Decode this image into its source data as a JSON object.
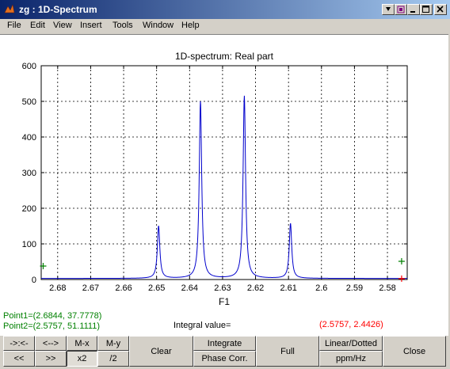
{
  "window": {
    "title": "zg : 1D-Spectrum"
  },
  "menu": [
    "File",
    "Edit",
    "View",
    "Insert",
    "Tools",
    "Window",
    "Help"
  ],
  "chart_data": {
    "type": "line",
    "title": "1D-spectrum: Real part",
    "xlabel": "F1",
    "ylabel": "",
    "xlim": [
      2.685,
      2.574
    ],
    "ylim": [
      0,
      600
    ],
    "x_reversed": true,
    "grid": true,
    "xticks": [
      2.68,
      2.67,
      2.66,
      2.65,
      2.64,
      2.63,
      2.62,
      2.61,
      2.6,
      2.59,
      2.58
    ],
    "xtick_labels": [
      "2.68",
      "2.67",
      "2.66",
      "2.65",
      "2.64",
      "2.63",
      "2.62",
      "2.61",
      "2.6",
      "2.59",
      "2.58"
    ],
    "yticks": [
      0,
      100,
      200,
      300,
      400,
      500,
      600
    ],
    "ytick_labels": [
      "0",
      "100",
      "200",
      "300",
      "400",
      "500",
      "600"
    ],
    "peaks": [
      {
        "x": 2.6494,
        "y": 150
      },
      {
        "x": 2.6367,
        "y": 500
      },
      {
        "x": 2.6234,
        "y": 515
      },
      {
        "x": 2.6094,
        "y": 157
      }
    ],
    "baseline": 3,
    "markers": [
      {
        "x": 2.6844,
        "y": 37.7778,
        "color": "#008000"
      },
      {
        "x": 2.5757,
        "y": 51.1111,
        "color": "#008000"
      },
      {
        "x": 2.5757,
        "y": 2.4426,
        "color": "#ff0000"
      }
    ],
    "series": [
      {
        "color": "#0000cc"
      }
    ]
  },
  "status": {
    "point1": "Point1=(2.6844, 37.7778)",
    "point2": "Point2=(2.5757, 51.1111)",
    "integral_label": "Integral value=",
    "integral_value": "(2.5757, 2.4426)"
  },
  "buttons": {
    "shift_right": "->:<-",
    "shift_left": "<-->",
    "mx": "M-x",
    "my": "M-y",
    "left2": "<<",
    "right2": ">>",
    "x2": "x2",
    "div2": "/2",
    "clear": "Clear",
    "integrate": "Integrate",
    "phase": "Phase Corr.",
    "full": "Full",
    "linear": "Linear/Dotted",
    "ppmhz": "ppm/Hz",
    "close": "Close"
  },
  "colors": {
    "titlebar": "#0a246a",
    "spectrum": "#0000cc",
    "point_text": "#008000",
    "integral_value": "#ff0000"
  }
}
